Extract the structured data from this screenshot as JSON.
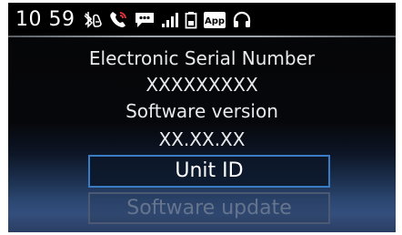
{
  "status_bar": {
    "time": "10 59",
    "icons": [
      "bluetooth-phone-icon",
      "phone-call-icon",
      "message-icon",
      "signal-strength-icon",
      "battery-icon",
      "app-icon",
      "headset-icon"
    ],
    "app_icon_label": "App",
    "signal_bars": 4
  },
  "info": {
    "esn_label": "Electronic Serial Number",
    "esn_value": "XXXXXXXXX",
    "software_label": "Software version",
    "software_value": "XX.XX.XX"
  },
  "menu": {
    "items": [
      {
        "label": "Unit ID",
        "state": "focused"
      },
      {
        "label": "Software update",
        "state": "disabled"
      }
    ]
  },
  "colors": {
    "focus_border": "#3a7cc4",
    "text": "#e8eaed",
    "disabled_text": "#66758e",
    "icon_accent": "#e8323c"
  }
}
